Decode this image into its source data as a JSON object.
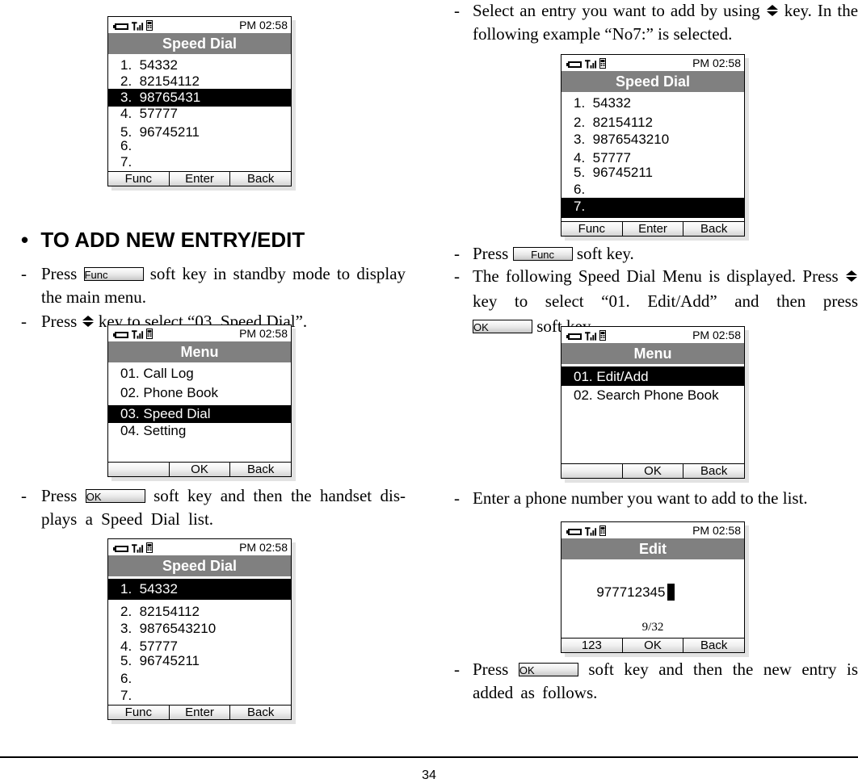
{
  "status_time": "PM 02:58",
  "screens": {
    "s1": {
      "title": "Speed Dial",
      "rows": [
        "1.  54332",
        "2.  82154112",
        "3.  98765431",
        "4.  57777",
        "5.  96745211",
        "6.",
        "7."
      ],
      "selected": 2,
      "softkeys": [
        "Func",
        "Enter",
        "Back"
      ]
    },
    "s2": {
      "title": "Menu",
      "rows": [
        "01. Call Log",
        "02. Phone Book",
        "03. Speed Dial",
        "04. Setting"
      ],
      "selected": 2,
      "softkeys": [
        "",
        "OK",
        "Back"
      ]
    },
    "s3": {
      "title": "Speed Dial",
      "rows": [
        "1.  54332",
        "2.  82154112",
        "3.  9876543210",
        "4.  57777",
        "5.  96745211",
        "6.",
        "7."
      ],
      "selected": 0,
      "softkeys": [
        "Func",
        "Enter",
        "Back"
      ]
    },
    "s4": {
      "title": "Speed Dial",
      "rows": [
        "1.  54332",
        "2.  82154112",
        "3.  9876543210",
        "4.  57777",
        "5.  96745211",
        "6.",
        "7."
      ],
      "selected": 6,
      "softkeys": [
        "Func",
        "Enter",
        "Back"
      ]
    },
    "s5": {
      "title": "Menu",
      "rows": [
        "01. Edit/Add",
        "02. Search Phone Book"
      ],
      "selected": 0,
      "softkeys": [
        "",
        "OK",
        "Back"
      ]
    },
    "s6": {
      "title": "Edit",
      "input_value": "977712345",
      "counter": "9/32",
      "softkeys": [
        "123",
        "OK",
        "Back"
      ]
    }
  },
  "heading": "TO ADD NEW ENTRY/EDIT",
  "bullet": "•",
  "dash": "-",
  "softkey_labels": {
    "func": "Func",
    "ok": "OK"
  },
  "steps": {
    "p1a": "Press",
    "p1b": "soft key in standby mode to display",
    "p1c": "the main menu.",
    "p2a": "Press",
    "p2b": "key to select “03. Speed Dial”.",
    "p3a": "Press",
    "p3b": "soft key and then the handset dis-",
    "p3c": "plays a Speed Dial list.",
    "p4a": "Select an entry you want to add by using",
    "p4b": "key. In",
    "p4c": "the following example “No7:” is selected.",
    "p5a": "Press",
    "p5b": "soft key.",
    "p6a": "The following Speed Dial Menu is displayed. Press",
    "p6b": "key to select “01. Edit/Add” and then press",
    "p6c": "soft key.",
    "p7": "Enter a phone number you want to add to the list.",
    "p8a": "Press",
    "p8b": "soft key and then the new entry is",
    "p8c": "added as follows."
  },
  "page_number": "34"
}
